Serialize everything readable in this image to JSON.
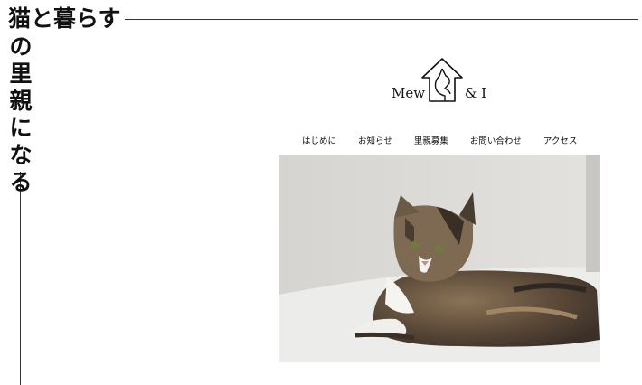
{
  "tagline": {
    "horizontal": "猫と暮らす",
    "vertical_chars": [
      "猫",
      "の",
      "里",
      "親",
      "に",
      "な",
      "る"
    ]
  },
  "logo": {
    "left_text": "Mew",
    "right_text": "& I",
    "icon": "house-cat-icon"
  },
  "nav": {
    "items": [
      {
        "label": "はじめに"
      },
      {
        "label": "お知らせ"
      },
      {
        "label": "里親募集"
      },
      {
        "label": "お問い合わせ"
      },
      {
        "label": "アクセス"
      }
    ]
  },
  "hero": {
    "image": "calico-cat-photo",
    "colors": {
      "background": "#d9d7d4",
      "floor": "#ececea"
    }
  }
}
